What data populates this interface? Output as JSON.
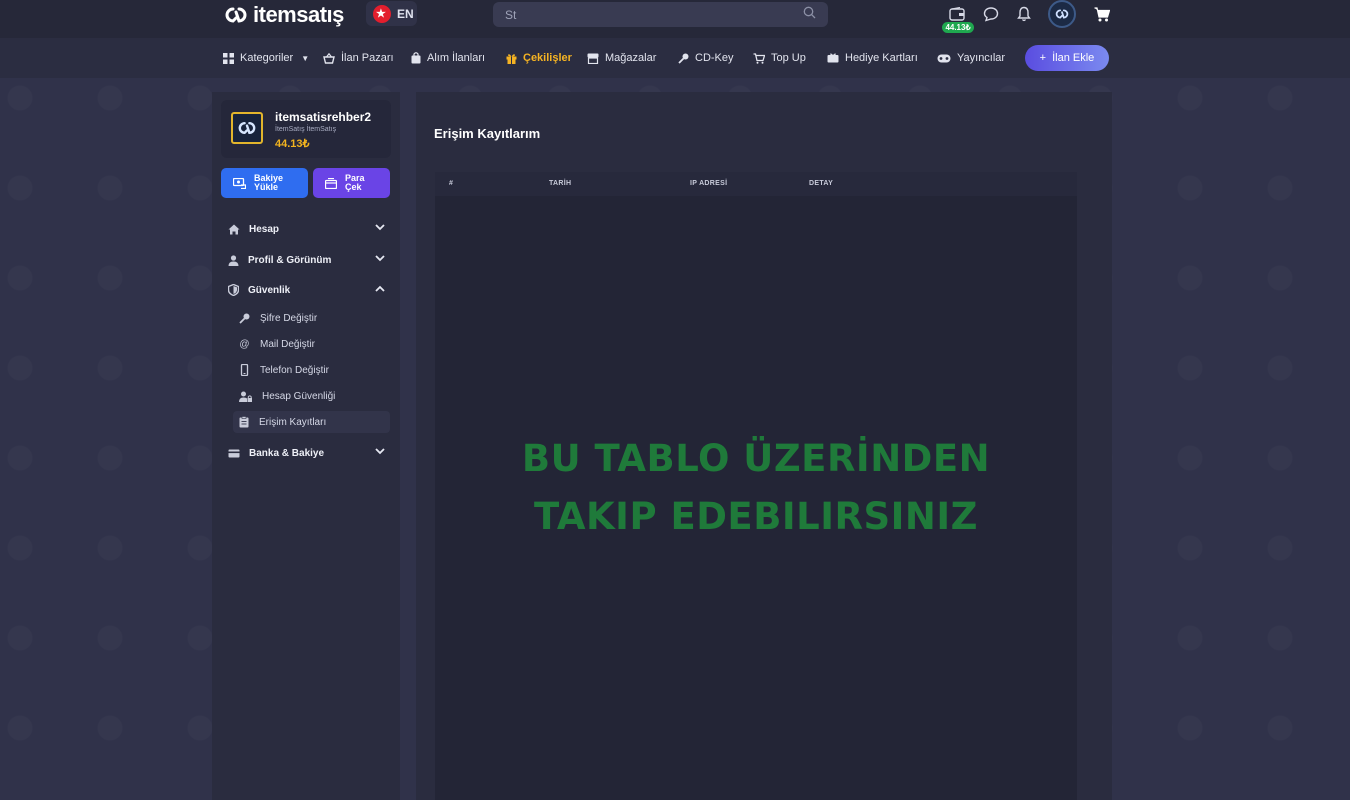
{
  "brand": {
    "name": "itemsatış"
  },
  "topbar": {
    "language": "EN",
    "search": {
      "value": "St",
      "placeholder": "St"
    },
    "wallet_balance": "44.13₺"
  },
  "nav": {
    "items": [
      {
        "label": "Kategoriler",
        "icon": "grid-icon"
      },
      {
        "label": "İlan Pazarı",
        "icon": "basket-icon"
      },
      {
        "label": "Alım İlanları",
        "icon": "bag-icon"
      },
      {
        "label": "Çekilişler",
        "icon": "gift-icon",
        "active": true
      },
      {
        "label": "Mağazalar",
        "icon": "store-icon"
      },
      {
        "label": "CD-Key",
        "icon": "key-icon"
      },
      {
        "label": "Top Up",
        "icon": "cart-icon"
      },
      {
        "label": "Hediye Kartları",
        "icon": "giftcard-icon"
      },
      {
        "label": "Yayıncılar",
        "icon": "gamepad-icon"
      }
    ],
    "add_button": "İlan Ekle",
    "active_color": "#f5b323"
  },
  "sidebar": {
    "profile": {
      "name": "itemsatisrehber2",
      "subtitle": "İtemSatış İtemSatış",
      "balance": "44.13₺"
    },
    "buttons": {
      "load_label_1": "Bakiye",
      "load_label_2": "Yükle",
      "withdraw_label_1": "Para",
      "withdraw_label_2": "Çek"
    },
    "groups": [
      {
        "label": "Hesap",
        "expanded": false
      },
      {
        "label": "Profil & Görünüm",
        "expanded": false
      },
      {
        "label": "Güvenlik",
        "expanded": true
      },
      {
        "label": "Banka & Bakiye",
        "expanded": false
      }
    ],
    "security_items": [
      {
        "label": "Şifre Değiştir"
      },
      {
        "label": "Mail Değiştir"
      },
      {
        "label": "Telefon Değiştir"
      },
      {
        "label": "Hesap Güvenliği"
      },
      {
        "label": "Erişim Kayıtları",
        "selected": true
      }
    ]
  },
  "main": {
    "title": "Erişim Kayıtlarım",
    "table": {
      "columns": [
        "#",
        "TARİH",
        "IP ADRESİ",
        "DETAY"
      ],
      "rows": []
    },
    "overlay": {
      "line1": "BU TABLO ÜZERİNDEN",
      "line2": "TAKIP EDEBILIRSINIZ",
      "color": "#1f7a3a"
    }
  }
}
